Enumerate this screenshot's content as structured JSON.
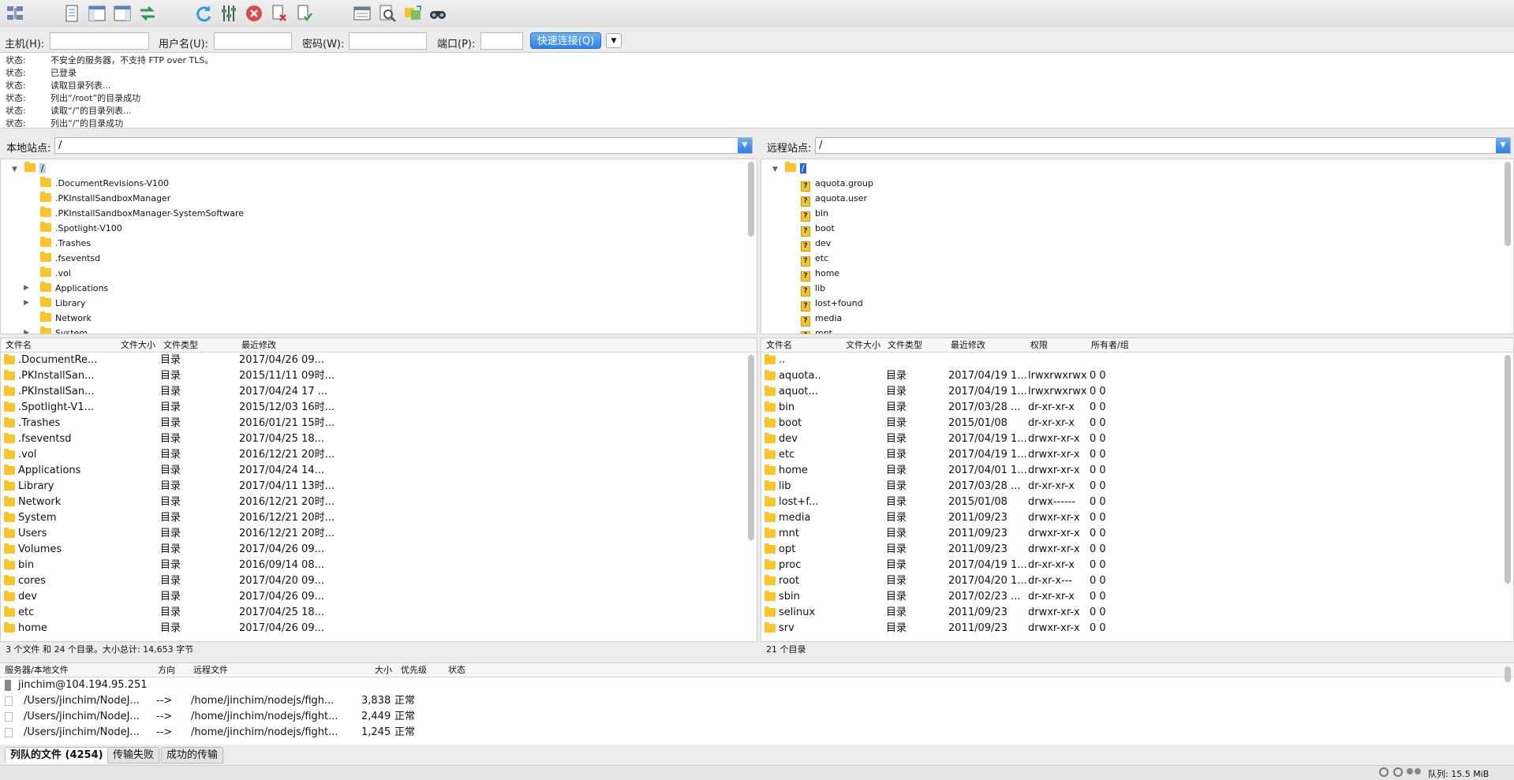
{
  "toolbar": {
    "icons": [
      "site-manager-icon",
      "toggle-log-icon",
      "toggle-local-tree-icon",
      "toggle-remote-tree-icon",
      "toggle-queue-icon",
      "refresh-icon",
      "filter-icon",
      "cancel-icon",
      "disconnect-icon",
      "reconnect-icon",
      "dir-compare-icon",
      "search-icon",
      "sync-browse-icon",
      "find-icon"
    ]
  },
  "quickconnect": {
    "host_label": "主机(H):",
    "user_label": "用户名(U):",
    "pass_label": "密码(W):",
    "port_label": "端口(P):",
    "host_value": "",
    "user_value": "",
    "pass_value": "",
    "port_value": "",
    "button": "快速连接(Q)"
  },
  "log": [
    {
      "k": "状态:",
      "v": "不安全的服务器，不支持 FTP over TLS。"
    },
    {
      "k": "状态:",
      "v": "已登录"
    },
    {
      "k": "状态:",
      "v": "读取目录列表..."
    },
    {
      "k": "状态:",
      "v": "列出“/root”的目录成功"
    },
    {
      "k": "状态:",
      "v": "读取“/”的目录列表..."
    },
    {
      "k": "状态:",
      "v": "列出“/”的目录成功"
    }
  ],
  "local": {
    "site_label": "本地站点:",
    "path": "/",
    "tree_root": "/",
    "tree": [
      ".DocumentRevisions-V100",
      ".PKInstallSandboxManager",
      ".PKInstallSandboxManager-SystemSoftware",
      ".Spotlight-V100",
      ".Trashes",
      ".fseventsd",
      ".vol",
      "Applications",
      "Library",
      "Network",
      "System"
    ],
    "headers": {
      "name": "文件名",
      "size": "文件大小",
      "type": "文件类型",
      "modified": "最近修改"
    },
    "rows": [
      [
        ".DocumentRe...",
        "目录",
        "2017/04/26 09..."
      ],
      [
        ".PKInstallSan...",
        "目录",
        "2015/11/11 09时..."
      ],
      [
        ".PKInstallSan...",
        "目录",
        "2017/04/24 17 ..."
      ],
      [
        ".Spotlight-V1...",
        "目录",
        "2015/12/03 16时..."
      ],
      [
        ".Trashes",
        "目录",
        "2016/01/21 15时..."
      ],
      [
        ".fseventsd",
        "目录",
        "2017/04/25 18..."
      ],
      [
        ".vol",
        "目录",
        "2016/12/21 20时..."
      ],
      [
        "Applications",
        "目录",
        "2017/04/24 14..."
      ],
      [
        "Library",
        "目录",
        "2017/04/11 13时..."
      ],
      [
        "Network",
        "目录",
        "2016/12/21 20时..."
      ],
      [
        "System",
        "目录",
        "2016/12/21 20时..."
      ],
      [
        "Users",
        "目录",
        "2016/12/21 20时..."
      ],
      [
        "Volumes",
        "目录",
        "2017/04/26 09..."
      ],
      [
        "bin",
        "目录",
        "2016/09/14 08..."
      ],
      [
        "cores",
        "目录",
        "2017/04/20 09..."
      ],
      [
        "dev",
        "目录",
        "2017/04/26 09..."
      ],
      [
        "etc",
        "目录",
        "2017/04/25 18..."
      ],
      [
        "home",
        "目录",
        "2017/04/26 09..."
      ]
    ],
    "status": "3 个文件 和 24 个目录。大小总计: 14,653 字节"
  },
  "remote": {
    "site_label": "远程站点:",
    "path": "/",
    "tree_root": "/",
    "tree": [
      "aquota.group",
      "aquota.user",
      "bin",
      "boot",
      "dev",
      "etc",
      "home",
      "lib",
      "lost+found",
      "media",
      "mnt"
    ],
    "headers": {
      "name": "文件名",
      "size": "文件大小",
      "type": "文件类型",
      "modified": "最近修改",
      "perms": "权限",
      "owner": "所有者/组"
    },
    "parent": "..",
    "rows": [
      [
        "aquota..",
        "目录",
        "2017/04/19 1...",
        "lrwxrwxrwx",
        "0 0"
      ],
      [
        "aquot...",
        "目录",
        "2017/04/19 1...",
        "lrwxrwxrwx",
        "0 0"
      ],
      [
        "bin",
        "目录",
        "2017/03/28 ...",
        "dr-xr-xr-x",
        "0 0"
      ],
      [
        "boot",
        "目录",
        "2015/01/08",
        "dr-xr-xr-x",
        "0 0"
      ],
      [
        "dev",
        "目录",
        "2017/04/19 1...",
        "drwxr-xr-x",
        "0 0"
      ],
      [
        "etc",
        "目录",
        "2017/04/19 1...",
        "drwxr-xr-x",
        "0 0"
      ],
      [
        "home",
        "目录",
        "2017/04/01 1...",
        "drwxr-xr-x",
        "0 0"
      ],
      [
        "lib",
        "目录",
        "2017/03/28 ...",
        "dr-xr-xr-x",
        "0 0"
      ],
      [
        "lost+f...",
        "目录",
        "2015/01/08",
        "drwx------",
        "0 0"
      ],
      [
        "media",
        "目录",
        "2011/09/23",
        "drwxr-xr-x",
        "0 0"
      ],
      [
        "mnt",
        "目录",
        "2011/09/23",
        "drwxr-xr-x",
        "0 0"
      ],
      [
        "opt",
        "目录",
        "2011/09/23",
        "drwxr-xr-x",
        "0 0"
      ],
      [
        "proc",
        "目录",
        "2017/04/19 1...",
        "dr-xr-xr-x",
        "0 0"
      ],
      [
        "root",
        "目录",
        "2017/04/20 1...",
        "dr-xr-x---",
        "0 0"
      ],
      [
        "sbin",
        "目录",
        "2017/02/23 ...",
        "dr-xr-xr-x",
        "0 0"
      ],
      [
        "selinux",
        "目录",
        "2011/09/23",
        "drwxr-xr-x",
        "0 0"
      ],
      [
        "srv",
        "目录",
        "2011/09/23",
        "drwxr-xr-x",
        "0 0"
      ]
    ],
    "status": "21 个目录"
  },
  "queue": {
    "headers": {
      "server": "服务器/本地文件",
      "dir": "方向",
      "remote": "远程文件",
      "size": "大小",
      "priority": "优先级",
      "status": "状态"
    },
    "server": "jinchim@104.194.95.251",
    "rows": [
      [
        "/Users/jinchim/NodeJ...",
        "-->",
        "/home/jinchim/nodejs/figh...",
        "3,838",
        "正常"
      ],
      [
        "/Users/jinchim/NodeJ...",
        "-->",
        "/home/jinchim/nodejs/fight...",
        "2,449",
        "正常"
      ],
      [
        "/Users/jinchim/NodeJ...",
        "-->",
        "/home/jinchim/nodejs/fight...",
        "1,245",
        "正常"
      ]
    ]
  },
  "tabs": [
    "列队的文件 (4254)",
    "传输失败",
    "成功的传输"
  ],
  "bottom": {
    "queue_label": "队列: 15.5 MiB"
  }
}
